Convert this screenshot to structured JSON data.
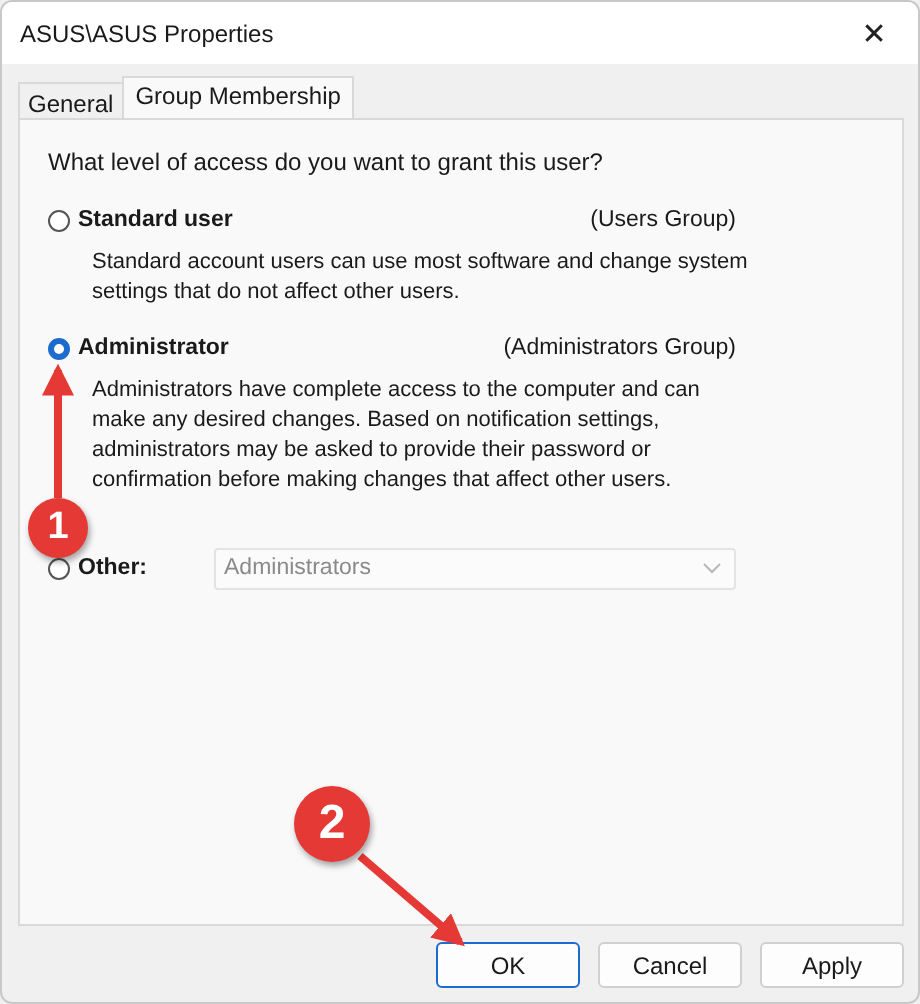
{
  "window": {
    "title": "ASUS\\ASUS Properties",
    "close": "✕"
  },
  "tabs": [
    {
      "label": "General",
      "selected": false
    },
    {
      "label": "Group Membership",
      "selected": true
    }
  ],
  "question": "What level of access do you want to grant this user?",
  "options": [
    {
      "kind": "described",
      "label": "Standard user",
      "group": "(Users Group)",
      "description": "Standard account users can use most software and change system settings that do not affect other users.",
      "selected": false
    },
    {
      "kind": "described",
      "label": "Administrator",
      "group": "(Administrators Group)",
      "description": "Administrators have complete access to the computer and can make any desired changes. Based on notification settings, administrators may be asked to provide their password or confirmation before making changes that affect other users.",
      "selected": true
    },
    {
      "kind": "dropdown",
      "label": "Other:",
      "value": "Administrators",
      "disabled": true,
      "selected": false
    }
  ],
  "buttons": [
    {
      "label": "OK",
      "default": true
    },
    {
      "label": "Cancel",
      "default": false
    },
    {
      "label": "Apply",
      "default": false
    }
  ],
  "annotations": [
    {
      "number": "1"
    },
    {
      "number": "2"
    }
  ]
}
